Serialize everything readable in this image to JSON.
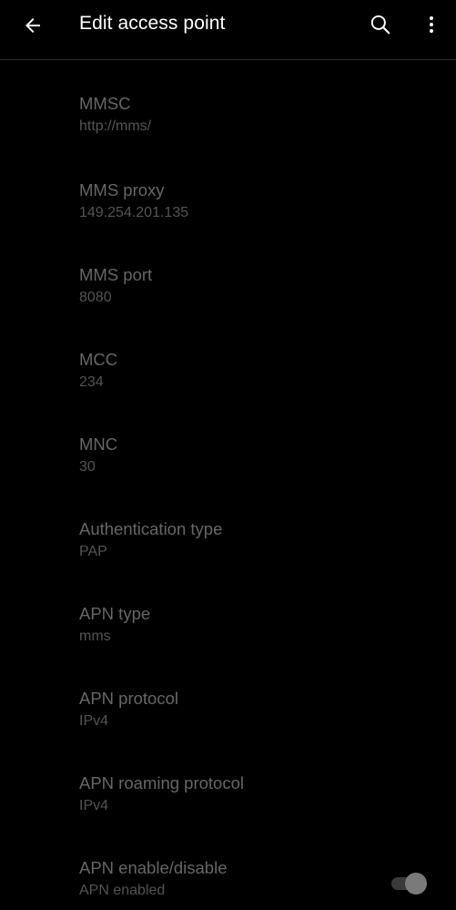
{
  "appbar": {
    "title": "Edit access point",
    "back_icon": "arrow-back-icon",
    "search_icon": "search-icon",
    "more_icon": "more-vert-icon"
  },
  "colors": {
    "background": "#000000",
    "title_text": "#ffffff",
    "pref_title_disabled": "#666666",
    "pref_summary_disabled": "#545454"
  },
  "preferences": [
    {
      "title": "MMSC",
      "summary": "http://mms/"
    },
    {
      "title": "MMS proxy",
      "summary": "149.254.201.135"
    },
    {
      "title": "MMS port",
      "summary": "8080"
    },
    {
      "title": "MCC",
      "summary": "234"
    },
    {
      "title": "MNC",
      "summary": "30"
    },
    {
      "title": "Authentication type",
      "summary": "PAP"
    },
    {
      "title": "APN type",
      "summary": "mms"
    },
    {
      "title": "APN protocol",
      "summary": "IPv4"
    },
    {
      "title": "APN roaming protocol",
      "summary": "IPv4"
    },
    {
      "title": "APN enable/disable",
      "summary": "APN enabled",
      "toggle_on": true
    }
  ]
}
